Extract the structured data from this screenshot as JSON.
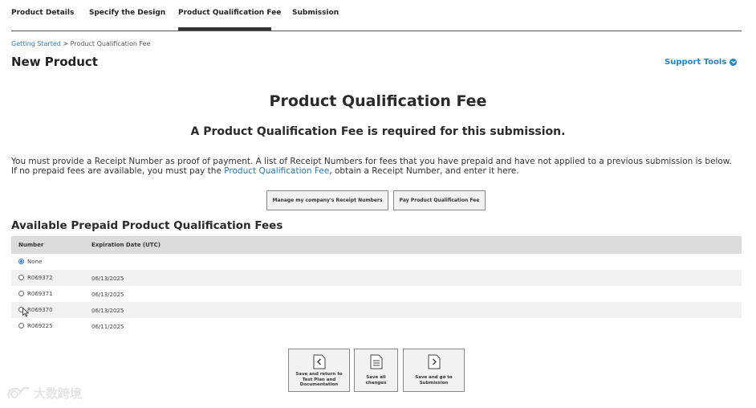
{
  "tabs": [
    {
      "label": "Product Details"
    },
    {
      "label": "Specify the Design"
    },
    {
      "label": "Product Qualification Fee",
      "active": true
    },
    {
      "label": "Submission"
    }
  ],
  "breadcrumb": {
    "link": "Getting Started",
    "separator": " > ",
    "current": "Product Qualification Fee"
  },
  "page_title": "New Product",
  "support_tools": {
    "label": "Support Tools",
    "icon": "chevron-down-circle-icon"
  },
  "heading": "Product Qualification Fee",
  "subheading": "A Product Qualification Fee is required for this submission.",
  "description": {
    "before_link": "You must provide a Receipt Number as proof of payment. A list of Receipt Numbers for fees that you have prepaid and have not applied to a previous submission is below. If no prepaid fees are available, you must pay the ",
    "link": "Product Qualification Fee",
    "after_link": ", obtain a Receipt Number, and enter it here."
  },
  "buttons": {
    "manage_receipts": "Manage my company's Receipt Numbers",
    "pay_fee": "Pay Product Qualification Fee"
  },
  "section_title": "Available Prepaid Product Qualification Fees",
  "table": {
    "headers": [
      "Number",
      "Expiration Date (UTC)"
    ],
    "rows": [
      {
        "number": "None",
        "date": "",
        "selected": true
      },
      {
        "number": "R069372",
        "date": "06/13/2025",
        "selected": false
      },
      {
        "number": "R069371",
        "date": "06/13/2025",
        "selected": false
      },
      {
        "number": "R069370",
        "date": "06/13/2025",
        "selected": false
      },
      {
        "number": "R069225",
        "date": "06/11/2025",
        "selected": false
      }
    ]
  },
  "footer_buttons": [
    {
      "label": "Save and return to Test Plan and Documentation",
      "icon": "chevron-left-icon"
    },
    {
      "label": "Save all changes",
      "icon": "document-icon"
    },
    {
      "label": "Save and go to Submission",
      "icon": "chevron-right-icon"
    }
  ],
  "watermark": {
    "text": "大数跨境"
  },
  "colors": {
    "link": "#2a78b8",
    "accent": "#1f86c7",
    "radio_selected": "#1f6fd1",
    "table_header": "#dcdcdc"
  }
}
